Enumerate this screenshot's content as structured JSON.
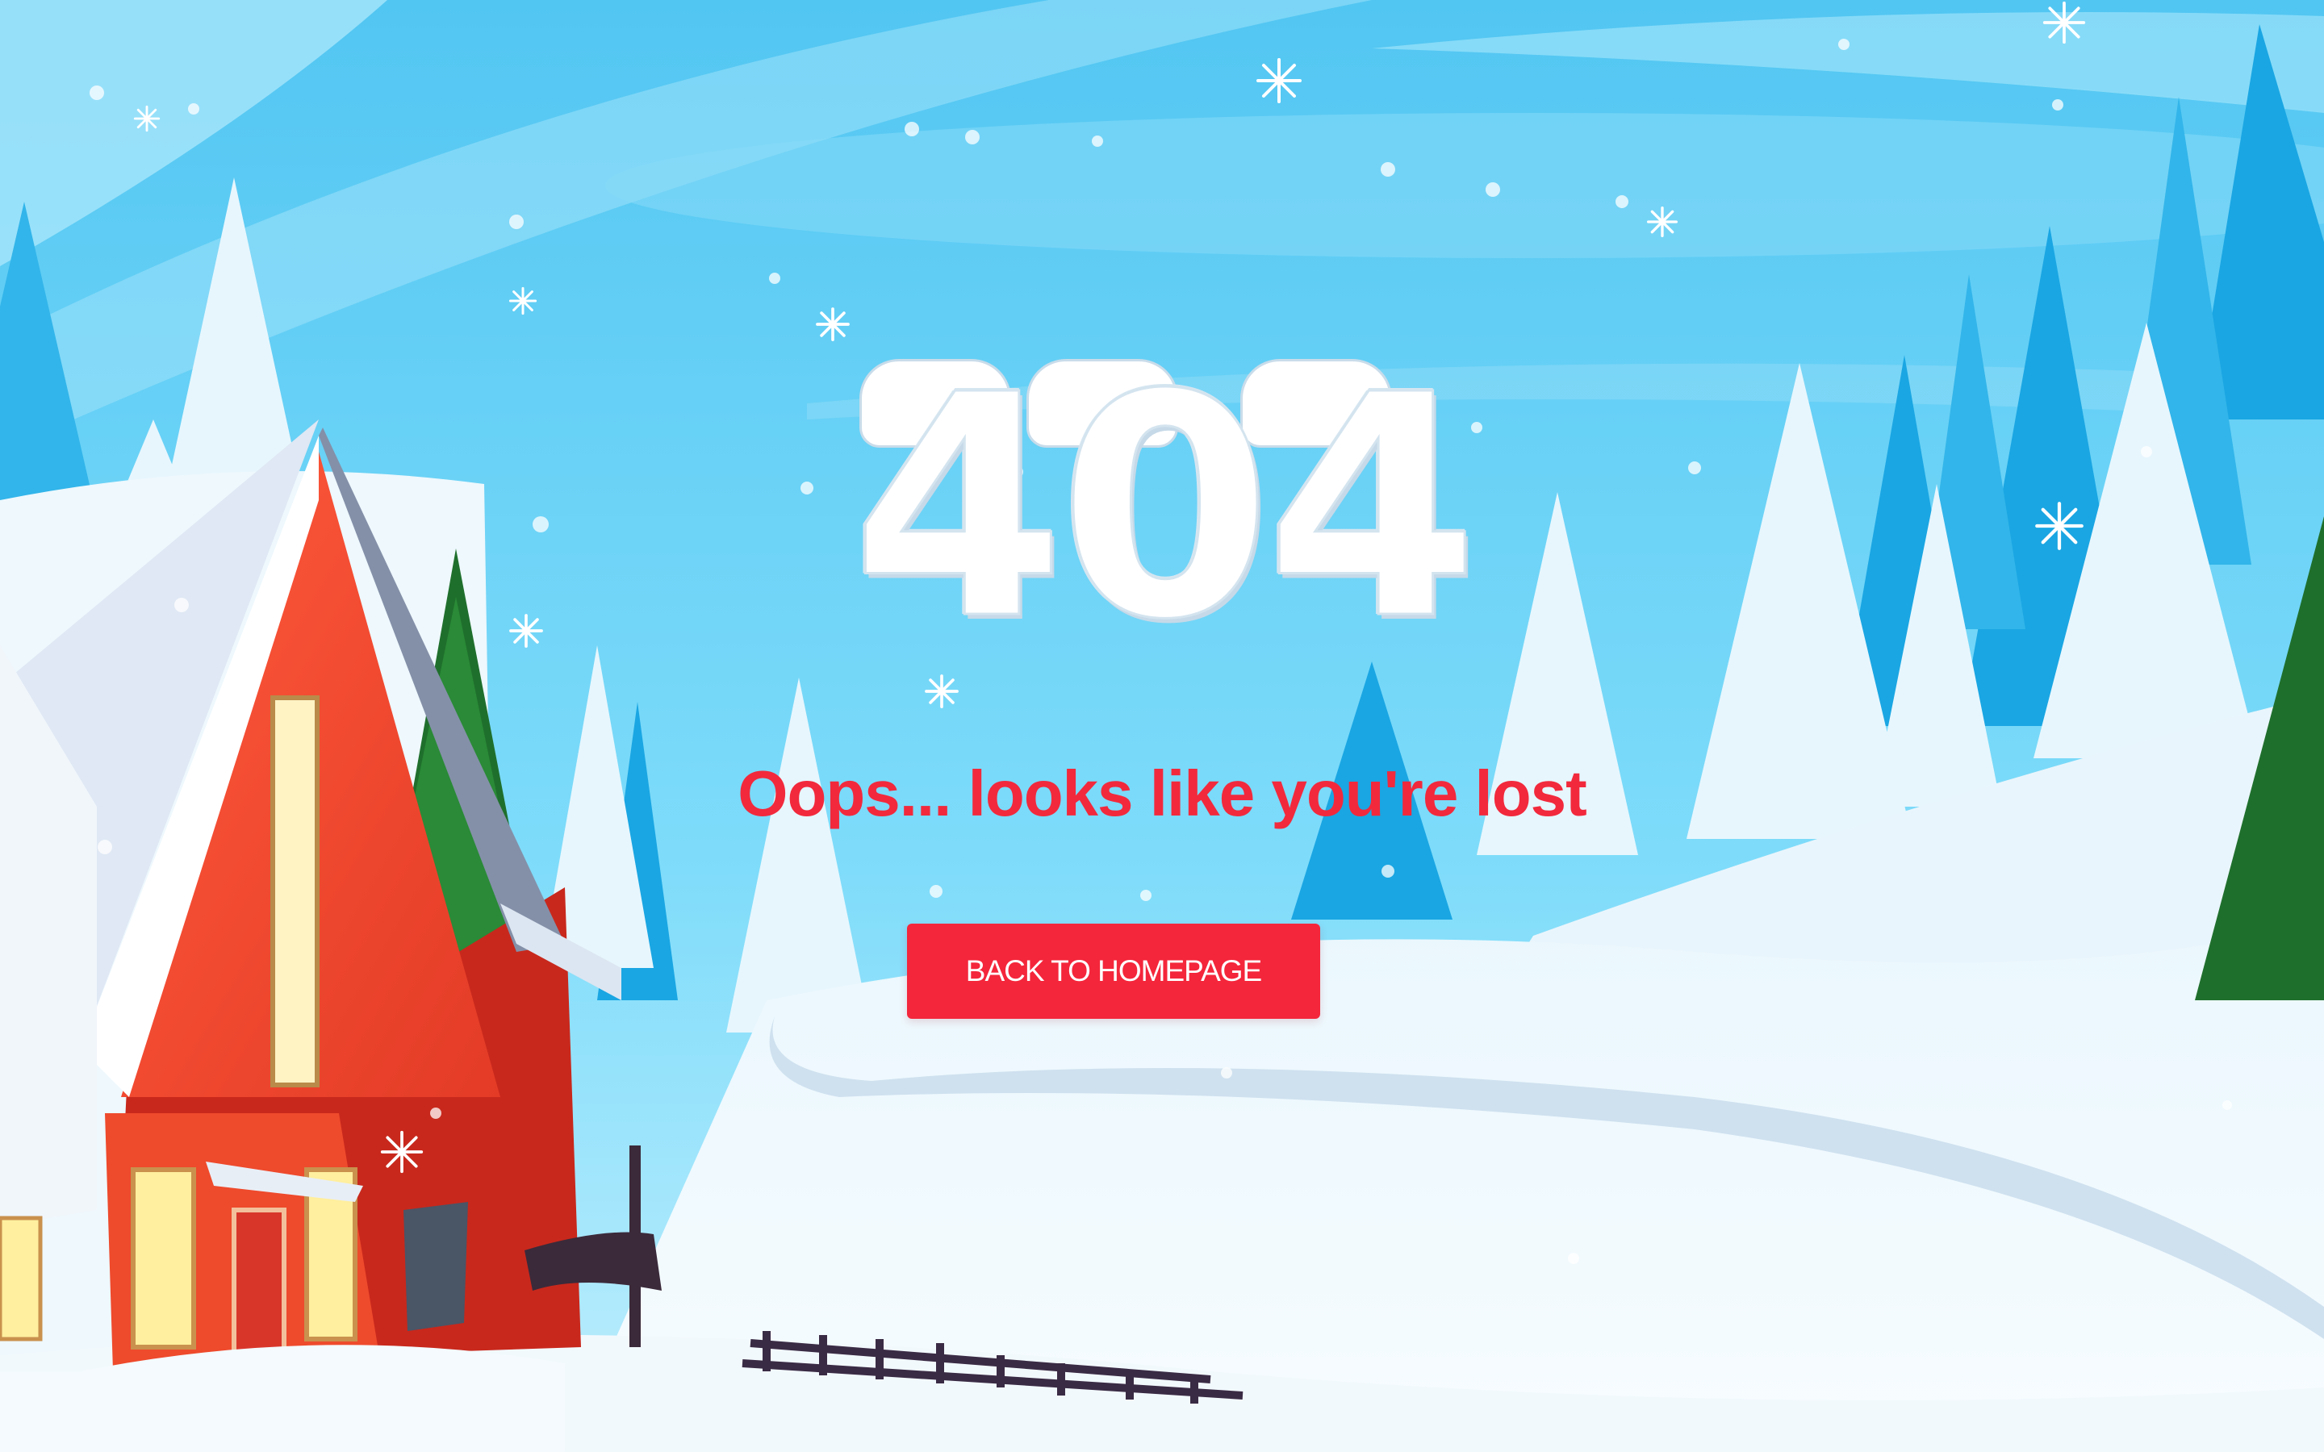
{
  "error_page": {
    "code": "404",
    "message": "Oops... looks like you're lost",
    "button_label": "BACK TO HOMEPAGE"
  },
  "colors": {
    "sky": "#5fd0f6",
    "accent": "#f4263b",
    "message_text": "#f2293c",
    "snow": "#ffffff"
  },
  "icons": [
    "snowflake-icon",
    "house-illustration",
    "pine-tree-illustration",
    "fence-illustration"
  ]
}
